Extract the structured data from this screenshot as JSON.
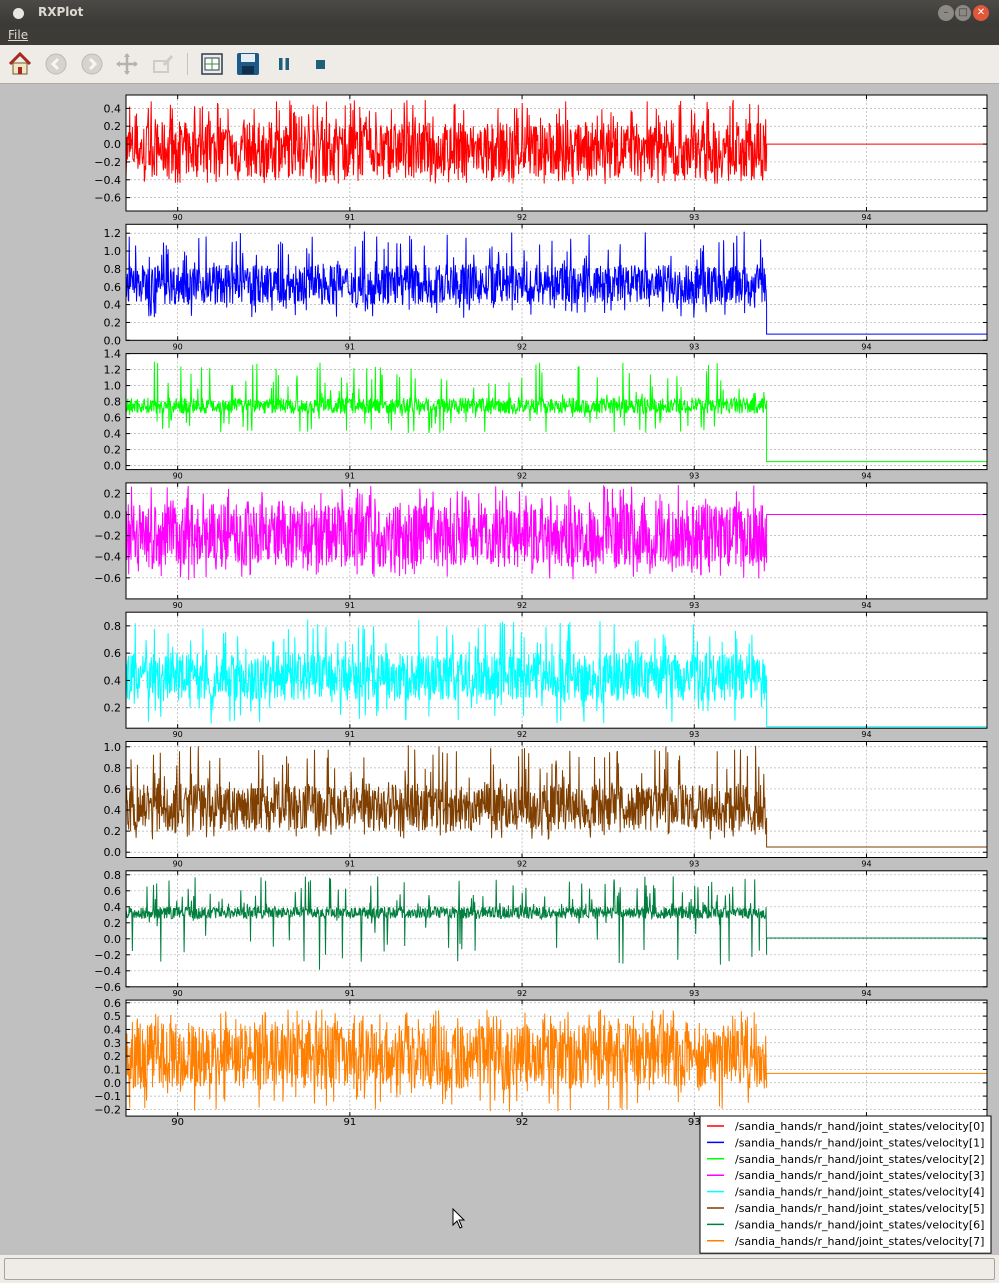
{
  "window": {
    "title": "RXPlot"
  },
  "menu": {
    "file": "File"
  },
  "toolbar": {
    "buttons": [
      "home-icon",
      "back-icon",
      "forward-icon",
      "pan-icon",
      "zoom-icon",
      "subplots-icon",
      "save-icon",
      "pause-icon",
      "stop-icon"
    ]
  },
  "chart_data": {
    "type": "line",
    "subplots": 8,
    "xlim": [
      89.7,
      94.7
    ],
    "xticks": [
      90,
      91,
      92,
      93,
      94
    ],
    "grid": true,
    "legend_placement": "bottom-right",
    "series": [
      {
        "name": "/sandia_hands/r_hand/joint_states/velocity[0]",
        "color": "#ff0000",
        "ylim": [
          -0.75,
          0.55
        ],
        "yticks": [
          -0.6,
          -0.4,
          -0.2,
          0.0,
          0.2,
          0.4
        ],
        "ytick_labels": [
          "−0.6",
          "−0.4",
          "−0.2",
          "0.0",
          "0.2",
          "0.4"
        ],
        "noisy_band": [
          -0.38,
          0.25
        ],
        "spike_min": -0.45,
        "spike_max": 0.5,
        "after_value": 0.0
      },
      {
        "name": "/sandia_hands/r_hand/joint_states/velocity[1]",
        "color": "#0000ff",
        "ylim": [
          0.0,
          1.3
        ],
        "yticks": [
          0.0,
          0.2,
          0.4,
          0.6,
          0.8,
          1.0,
          1.2
        ],
        "ytick_labels": [
          "0.0",
          "0.2",
          "0.4",
          "0.6",
          "0.8",
          "1.0",
          "1.2"
        ],
        "noisy_band": [
          0.4,
          0.85
        ],
        "spike_min": 0.25,
        "spike_max": 1.22,
        "after_value": 0.07
      },
      {
        "name": "/sandia_hands/r_hand/joint_states/velocity[2]",
        "color": "#00ff00",
        "ylim": [
          -0.05,
          1.4
        ],
        "yticks": [
          0.0,
          0.2,
          0.4,
          0.6,
          0.8,
          1.0,
          1.2,
          1.4
        ],
        "ytick_labels": [
          "0.0",
          "0.2",
          "0.4",
          "0.6",
          "0.8",
          "1.0",
          "1.2",
          "1.4"
        ],
        "noisy_band": [
          0.65,
          0.85
        ],
        "spike_min": 0.4,
        "spike_max": 1.3,
        "after_value": 0.05
      },
      {
        "name": "/sandia_hands/r_hand/joint_states/velocity[3]",
        "color": "#ff00ff",
        "ylim": [
          -0.8,
          0.3
        ],
        "yticks": [
          -0.6,
          -0.4,
          -0.2,
          0.0,
          0.2
        ],
        "ytick_labels": [
          "−0.6",
          "−0.4",
          "−0.2",
          "0.0",
          "0.2"
        ],
        "noisy_band": [
          -0.5,
          0.1
        ],
        "spike_min": -0.62,
        "spike_max": 0.28,
        "after_value": 0.0
      },
      {
        "name": "/sandia_hands/r_hand/joint_states/velocity[4]",
        "color": "#00ffff",
        "ylim": [
          0.05,
          0.9
        ],
        "yticks": [
          0.2,
          0.4,
          0.6,
          0.8
        ],
        "ytick_labels": [
          "0.2",
          "0.4",
          "0.6",
          "0.8"
        ],
        "noisy_band": [
          0.25,
          0.6
        ],
        "spike_min": 0.08,
        "spike_max": 0.85,
        "after_value": 0.06
      },
      {
        "name": "/sandia_hands/r_hand/joint_states/velocity[5]",
        "color": "#7f3f00",
        "ylim": [
          -0.05,
          1.05
        ],
        "yticks": [
          0.0,
          0.2,
          0.4,
          0.6,
          0.8,
          1.0
        ],
        "ytick_labels": [
          "0.0",
          "0.2",
          "0.4",
          "0.6",
          "0.8",
          "1.0"
        ],
        "noisy_band": [
          0.2,
          0.65
        ],
        "spike_min": 0.12,
        "spike_max": 1.02,
        "after_value": 0.05
      },
      {
        "name": "/sandia_hands/r_hand/joint_states/velocity[6]",
        "color": "#007f3f",
        "ylim": [
          -0.6,
          0.85
        ],
        "yticks": [
          -0.6,
          -0.4,
          -0.2,
          0.0,
          0.2,
          0.4,
          0.6,
          0.8
        ],
        "ytick_labels": [
          "−0.6",
          "−0.4",
          "−0.2",
          "0.0",
          "0.2",
          "0.4",
          "0.6",
          "0.8"
        ],
        "noisy_band": [
          0.25,
          0.4
        ],
        "spike_min": -0.4,
        "spike_max": 0.78,
        "after_value": 0.01
      },
      {
        "name": "/sandia_hands/r_hand/joint_states/velocity[7]",
        "color": "#ff7f00",
        "ylim": [
          -0.25,
          0.62
        ],
        "yticks": [
          -0.2,
          -0.1,
          0.0,
          0.1,
          0.2,
          0.3,
          0.4,
          0.5,
          0.6
        ],
        "ytick_labels": [
          "−0.2",
          "−0.1",
          "0.0",
          "0.1",
          "0.2",
          "0.3",
          "0.4",
          "0.5",
          "0.6"
        ],
        "noisy_band": [
          -0.05,
          0.45
        ],
        "spike_min": -0.22,
        "spike_max": 0.55,
        "after_value": 0.07
      }
    ],
    "step_change_x": 93.42
  }
}
